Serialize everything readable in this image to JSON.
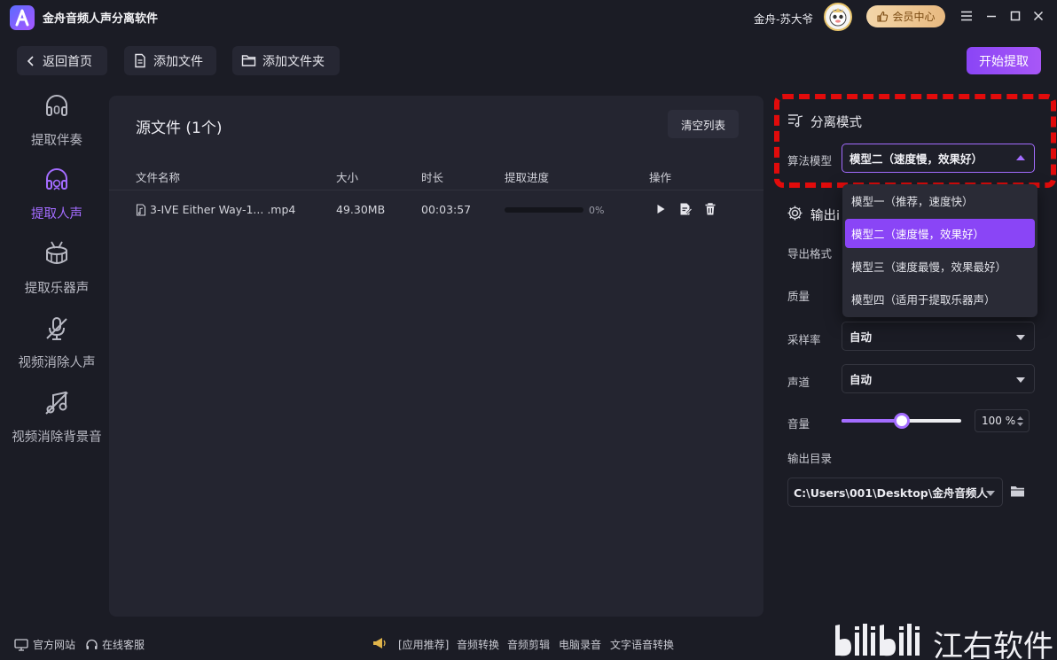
{
  "app": {
    "title": "金舟音频人声分离软件"
  },
  "header": {
    "username": "金舟-苏大爷",
    "vip_label": "会员中心"
  },
  "toolbar": {
    "back_label": "返回首页",
    "add_file_label": "添加文件",
    "add_folder_label": "添加文件夹",
    "start_label": "开始提取"
  },
  "sidebar": {
    "items": [
      {
        "label": "提取伴奏",
        "icon": "headphone-icon",
        "active": false
      },
      {
        "label": "提取人声",
        "icon": "vocal-headphone-icon",
        "active": true
      },
      {
        "label": "提取乐器声",
        "icon": "drum-icon",
        "active": false
      },
      {
        "label": "视频消除人声",
        "icon": "mic-off-icon",
        "active": false
      },
      {
        "label": "视频消除背景音",
        "icon": "music-off-icon",
        "active": false
      }
    ]
  },
  "file_list": {
    "title": "源文件 (1个)",
    "clear_label": "清空列表",
    "columns": [
      "文件名称",
      "大小",
      "时长",
      "提取进度",
      "操作"
    ],
    "rows": [
      {
        "name": "3-IVE Either Way-1... .mp4",
        "size": "49.30MB",
        "duration": "00:03:57",
        "progress_text": "0%",
        "progress": 0
      }
    ]
  },
  "separation": {
    "title": "分离模式",
    "model_label": "算法模型",
    "model_value": "模型二（速度慢，效果好）",
    "options": [
      "模型一（推荐，速度快）",
      "模型二（速度慢，效果好）",
      "模型三（速度最慢，效果最好）",
      "模型四（适用于提取乐器声）"
    ],
    "selected_index": 1
  },
  "output": {
    "title": "输出设置",
    "title_visible": "输出i",
    "format_label": "导出格式",
    "quality_label": "质量",
    "samplerate_label": "采样率",
    "samplerate_value": "自动",
    "channel_label": "声道",
    "channel_value": "自动",
    "volume_label": "音量",
    "volume_value": "100 %",
    "volume_level": 0.5,
    "dir_label": "输出目录",
    "dir_value": "C:\\Users\\001\\Desktop\\金舟音频人"
  },
  "footer": {
    "website": "官方网站",
    "service": "在线客服",
    "recommend": "[应用推荐]",
    "links": [
      "音频转换",
      "音频剪辑",
      "电脑录音",
      "文字语音转换"
    ]
  },
  "watermark": {
    "text": "江右软件"
  },
  "colors": {
    "accent": "#a36cff",
    "highlight": "#e10b0b",
    "background": "#1b1c25"
  }
}
